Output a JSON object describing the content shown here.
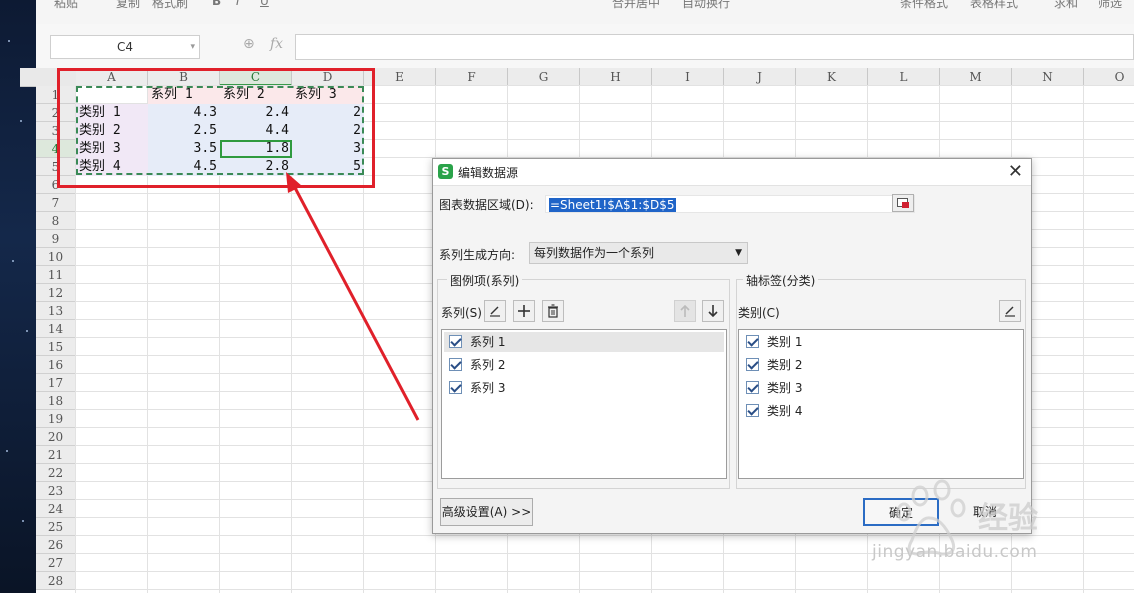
{
  "toolbar": {
    "items": [
      "粘贴",
      "复制",
      "格式刷",
      "B",
      "I",
      "U",
      "合并居中",
      "自动换行",
      "条件格式",
      "表格样式",
      "求和",
      "筛选"
    ]
  },
  "formula_bar": {
    "name_box": "C4",
    "fx_label": "fx",
    "formula": ""
  },
  "sheet": {
    "columns": [
      "A",
      "B",
      "C",
      "D",
      "E",
      "F",
      "G",
      "H",
      "I",
      "J",
      "K",
      "L",
      "M",
      "N",
      "O"
    ],
    "rows": [
      "1",
      "2",
      "3",
      "4",
      "5",
      "6",
      "7",
      "8",
      "9",
      "10",
      "11",
      "12",
      "13",
      "14",
      "15",
      "16",
      "17",
      "18",
      "19",
      "20",
      "21",
      "22",
      "23",
      "24",
      "25",
      "26",
      "27",
      "28"
    ],
    "header_row": [
      "",
      "系列 1",
      "系列 2",
      "系列 3"
    ],
    "data_rows": [
      [
        "类别 1",
        "4.3",
        "2.4",
        "2"
      ],
      [
        "类别 2",
        "2.5",
        "4.4",
        "2"
      ],
      [
        "类别 3",
        "3.5",
        "1.8",
        "3"
      ],
      [
        "类别 4",
        "4.5",
        "2.8",
        "5"
      ]
    ]
  },
  "dialog": {
    "title": "编辑数据源",
    "range_label": "图表数据区域(D):",
    "range_value": "=Sheet1!$A$1:$D$5",
    "direction_label": "系列生成方向:",
    "direction_value": "每列数据作为一个系列",
    "legend_group_title": "图例项(系列)",
    "series_label": "系列(S)",
    "series_items": [
      "系列 1",
      "系列 2",
      "系列 3"
    ],
    "axis_group_title": "轴标签(分类)",
    "category_label": "类别(C)",
    "category_items": [
      "类别 1",
      "类别 2",
      "类别 3",
      "类别 4"
    ],
    "advanced_button": "高级设置(A) >>",
    "ok_button": "确定",
    "cancel_button": "取消"
  },
  "watermark": {
    "text": "jingyan.baidu.com"
  }
}
